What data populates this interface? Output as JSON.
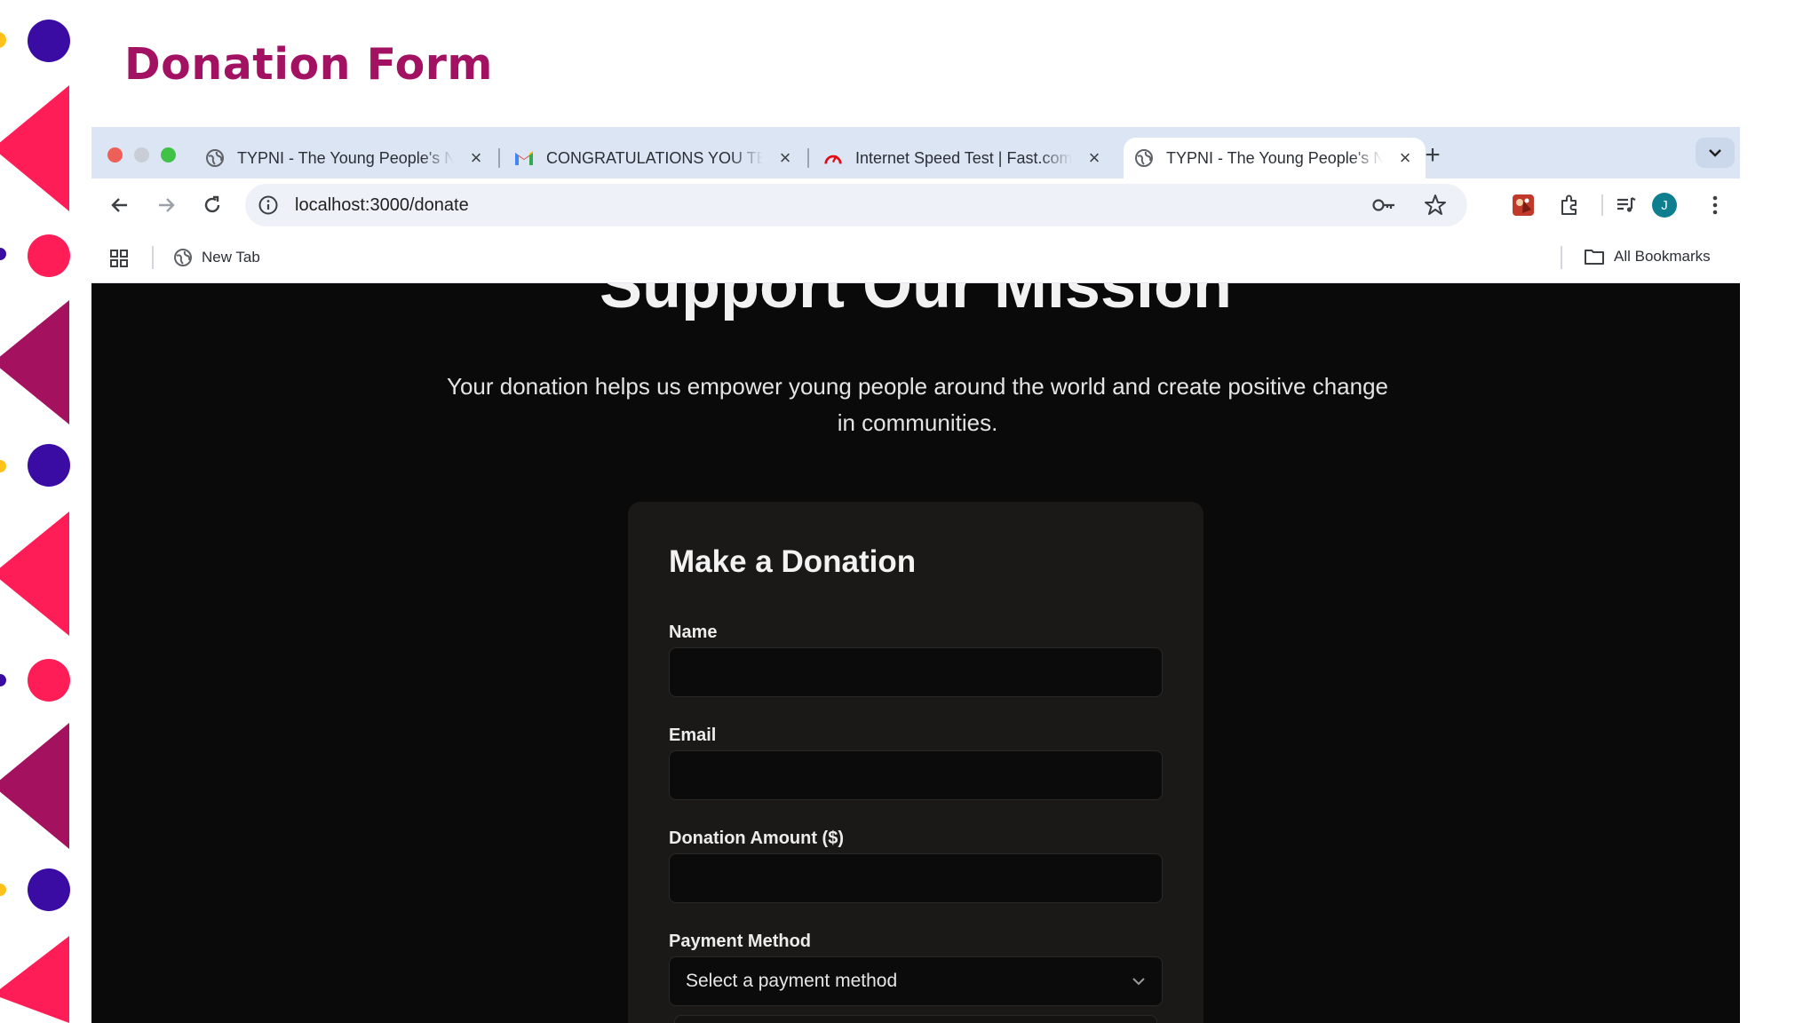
{
  "slide": {
    "title": "Donation Form"
  },
  "colors": {
    "slide_title": "#a31163",
    "deco_pink": "#ff1d58",
    "deco_magenta": "#a4125f",
    "deco_purple": "#3a0ca3",
    "deco_yellow": "#ffc21a",
    "page_background": "#0a0a0a",
    "card_background": "#1b1918",
    "profile_avatar": "#0f7f8f"
  },
  "browser": {
    "tabs": [
      {
        "title": "TYPNI - The Young People's Network International",
        "favicon": "globe-icon",
        "active": false
      },
      {
        "title": "CONGRATULATIONS YOU TEAM",
        "favicon": "gmail-icon",
        "active": false
      },
      {
        "title": "Internet Speed Test | Fast.com",
        "favicon": "gauge-icon",
        "active": false
      },
      {
        "title": "TYPNI - The Young People's Network International",
        "favicon": "globe-icon",
        "active": true
      }
    ],
    "url": "localhost:3000/donate",
    "profile_initial": "J",
    "bookmarks": [
      {
        "label": "New Tab",
        "icon": "globe-icon"
      }
    ],
    "all_bookmarks_label": "All Bookmarks"
  },
  "page": {
    "hero_title": "Support Our Mission",
    "subtitle": "Your donation helps us empower young people around the world and create positive change in communities.",
    "form": {
      "heading": "Make a Donation",
      "name_label": "Name",
      "name_value": "",
      "email_label": "Email",
      "email_value": "",
      "amount_label": "Donation Amount ($)",
      "amount_value": "",
      "payment_label": "Payment Method",
      "payment_placeholder": "Select a payment method"
    }
  }
}
